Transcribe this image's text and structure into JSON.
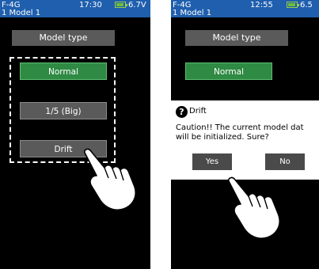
{
  "left_screen": {
    "status": {
      "model_num": "F-4G",
      "model_name": "1  Model 1",
      "time": "17:30",
      "voltage": "6.7V"
    },
    "title": "Model type",
    "options": [
      "Normal",
      "1/5 (Big)",
      "Drift"
    ]
  },
  "right_screen": {
    "status": {
      "model_num": "F-4G",
      "model_name": "1  Model 1",
      "time": "12:55",
      "voltage": "6.5"
    },
    "title": "Model type",
    "option": "Normal",
    "dialog": {
      "icon": "?",
      "title": "Drift",
      "message_line1": "Caution!! The current model dat",
      "message_line2": "will be initialized. Sure?",
      "yes_label": "Yes",
      "no_label": "No"
    }
  },
  "colors": {
    "status_bar": "#1f5fae",
    "selected": "#2f8a44",
    "button": "#5a5a5a",
    "battery": "#6fbf3a"
  }
}
